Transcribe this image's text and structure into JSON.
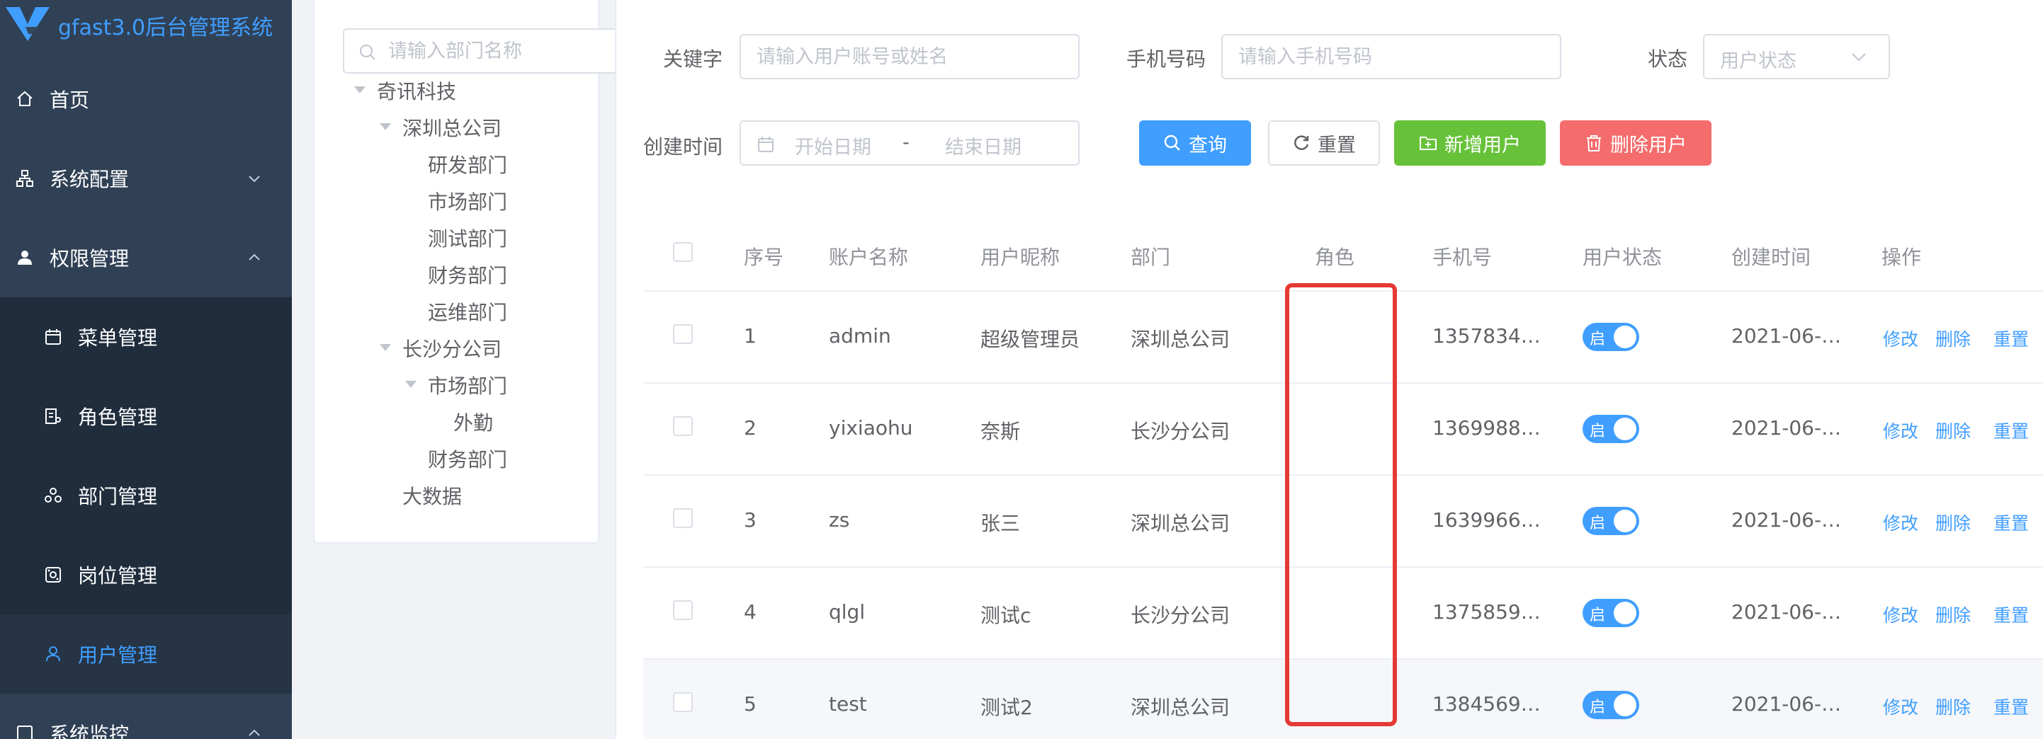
{
  "app": {
    "title": "gfast3.0后台管理系统",
    "accent": "#409eff",
    "sidebar_bg": "#304156"
  },
  "sidebar": {
    "home": "首页",
    "system_config": "系统配置",
    "permission": "权限管理",
    "menu_mgmt": "菜单管理",
    "role_mgmt": "角色管理",
    "dept_mgmt": "部门管理",
    "post_mgmt": "岗位管理",
    "user_mgmt": "用户管理",
    "monitor": "系统监控"
  },
  "tree": {
    "search_placeholder": "请输入部门名称",
    "nodes": {
      "root": "奇讯科技",
      "shenzhen": "深圳总公司",
      "dev": "研发部门",
      "market": "市场部门",
      "test": "测试部门",
      "finance": "财务部门",
      "ops": "运维部门",
      "changsha": "长沙分公司",
      "cs_market": "市场部门",
      "waiqin": "外勤",
      "cs_finance": "财务部门",
      "bigdata": "大数据"
    }
  },
  "filters": {
    "keyword_label": "关键字",
    "keyword_placeholder": "请输入用户账号或姓名",
    "phone_label": "手机号码",
    "phone_placeholder": "请输入手机号码",
    "status_label": "状态",
    "status_placeholder": "用户状态",
    "created_label": "创建时间",
    "start_placeholder": "开始日期",
    "range_sep": "-",
    "end_placeholder": "结束日期"
  },
  "buttons": {
    "query": "查询",
    "reset": "重置",
    "add_user": "新增用户",
    "delete_user": "删除用户"
  },
  "table": {
    "headers": {
      "index": "序号",
      "account": "账户名称",
      "nickname": "用户昵称",
      "dept": "部门",
      "role": "角色",
      "phone": "手机号",
      "status": "用户状态",
      "created": "创建时间",
      "actions": "操作"
    },
    "rows": [
      {
        "index": "1",
        "account": "admin",
        "nickname": "超级管理员",
        "dept": "深圳总公司",
        "role": "",
        "phone": "1357834…",
        "status": "启",
        "created": "2021-06-…",
        "edit": "修改",
        "delete": "删除",
        "reset": "重置"
      },
      {
        "index": "2",
        "account": "yixiaohu",
        "nickname": "奈斯",
        "dept": "长沙分公司",
        "role": "",
        "phone": "1369988…",
        "status": "启",
        "created": "2021-06-…",
        "edit": "修改",
        "delete": "删除",
        "reset": "重置"
      },
      {
        "index": "3",
        "account": "zs",
        "nickname": "张三",
        "dept": "深圳总公司",
        "role": "",
        "phone": "1639966…",
        "status": "启",
        "created": "2021-06-…",
        "edit": "修改",
        "delete": "删除",
        "reset": "重置"
      },
      {
        "index": "4",
        "account": "qlgl",
        "nickname": "测试c",
        "dept": "长沙分公司",
        "role": "",
        "phone": "1375859…",
        "status": "启",
        "created": "2021-06-…",
        "edit": "修改",
        "delete": "删除",
        "reset": "重置"
      },
      {
        "index": "5",
        "account": "test",
        "nickname": "测试2",
        "dept": "深圳总公司",
        "role": "",
        "phone": "1384569…",
        "status": "启",
        "created": "2021-06-…",
        "edit": "修改",
        "delete": "删除",
        "reset": "重置"
      }
    ]
  },
  "annotation": {
    "color": "#e53935"
  }
}
